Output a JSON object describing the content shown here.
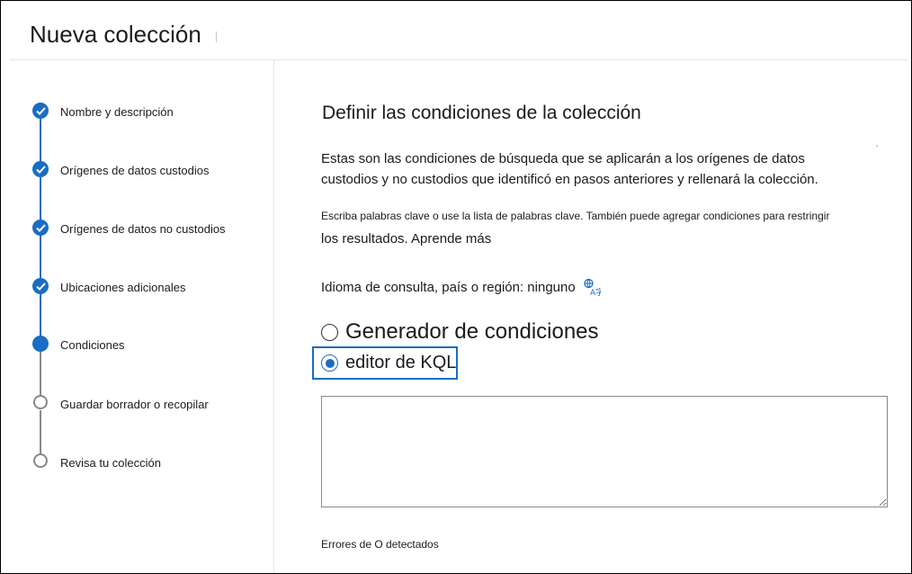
{
  "page": {
    "title": "Nueva colección"
  },
  "steps": [
    {
      "label": "Nombre y descripción",
      "state": "done"
    },
    {
      "label": "Orígenes de datos custodios",
      "state": "done"
    },
    {
      "label": "Orígenes de datos no custodios",
      "state": "done"
    },
    {
      "label": "Ubicaciones adicionales",
      "state": "done"
    },
    {
      "label": "Condiciones",
      "state": "current"
    },
    {
      "label": "Guardar borrador o recopilar",
      "state": "todo"
    },
    {
      "label": "Revisa tu colección",
      "state": "todo"
    }
  ],
  "main": {
    "heading": "Definir las condiciones de la colección",
    "intro_line1": "Estas son las condiciones de búsqueda que se aplicarán a los orígenes de datos",
    "intro_line2": "custodios y no custodios que identificó en pasos anteriores y rellenará la colección.",
    "hint_line1": "Escriba palabras clave o use la lista de palabras clave. También puede agregar condiciones para restringir",
    "hint_line2": "los resultados. Aprende más",
    "query_language": "Idioma de consulta, país o región: ninguno",
    "query_language_icon": "translate-icon",
    "options": [
      {
        "label": "Generador de condiciones",
        "checked": false
      },
      {
        "label": "editor de KQL",
        "checked": true
      }
    ],
    "kql_value": "",
    "errors": "Errores de O detectados"
  },
  "colors": {
    "accent": "#1a6dc2",
    "pending": "#8a8886"
  }
}
